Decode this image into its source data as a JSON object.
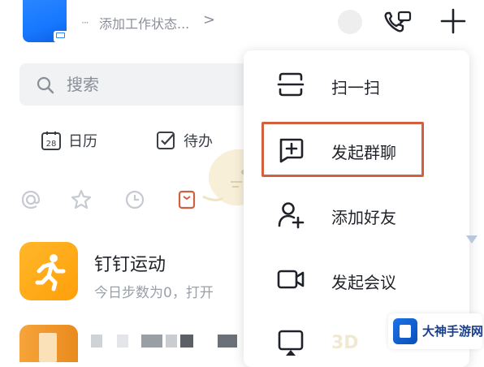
{
  "header": {
    "status_dots": "···",
    "status_text": "添加工作状态...",
    "status_chevron": ">"
  },
  "search": {
    "placeholder": "搜索"
  },
  "shortcuts": [
    {
      "label": "日历",
      "icon": "calendar-icon",
      "icon_text": "28"
    },
    {
      "label": "待办",
      "icon": "checkbox-icon"
    }
  ],
  "filters": [
    {
      "icon": "at-icon"
    },
    {
      "icon": "star-icon"
    },
    {
      "icon": "clock-icon"
    },
    {
      "icon": "document-icon"
    }
  ],
  "chats": [
    {
      "title": "钉钉运动",
      "subtitle": "今日步数为0，打开",
      "icon": "running-person-icon",
      "color": "#ff9f0a"
    }
  ],
  "menu": {
    "items": [
      {
        "label": "扫一扫",
        "icon": "scan-icon"
      },
      {
        "label": "发起群聊",
        "icon": "new-group-chat-icon",
        "highlighted": true
      },
      {
        "label": "添加好友",
        "icon": "add-friend-icon"
      },
      {
        "label": "发起会议",
        "icon": "video-meeting-icon"
      },
      {
        "label": "",
        "icon": "screen-cast-icon"
      }
    ]
  },
  "watermark": {
    "text": "3D",
    "logo_text": "大神手游网"
  },
  "colors": {
    "accent_blue": "#1677ff",
    "highlight_border": "#d0603f",
    "sport_orange": "#ff9f0a"
  }
}
